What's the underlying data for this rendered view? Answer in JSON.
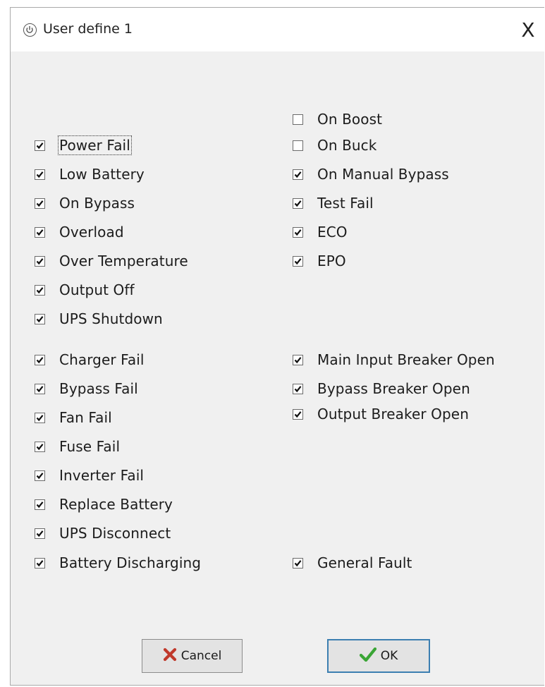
{
  "window": {
    "title": "User define 1",
    "close_label": "X"
  },
  "icons": {
    "app": "ups-power-icon",
    "close": "close-icon",
    "cancel": "red-x-icon",
    "ok": "green-check-icon"
  },
  "colors": {
    "dialog_bg": "#f0f0f0",
    "cancel_icon": "#c0392b",
    "ok_icon": "#3aa535",
    "ok_border": "#3c7fb1"
  },
  "options": {
    "on_boost": {
      "label": "On Boost",
      "checked": false
    },
    "on_buck": {
      "label": "On Buck",
      "checked": false
    },
    "power_fail": {
      "label": "Power Fail",
      "checked": true
    },
    "on_manual_bypass": {
      "label": "On Manual Bypass",
      "checked": true
    },
    "low_battery": {
      "label": "Low Battery",
      "checked": true
    },
    "test_fail": {
      "label": "Test Fail",
      "checked": true
    },
    "on_bypass": {
      "label": "On Bypass",
      "checked": true
    },
    "eco": {
      "label": "ECO",
      "checked": true
    },
    "overload": {
      "label": "Overload",
      "checked": true
    },
    "epo": {
      "label": "EPO",
      "checked": true
    },
    "over_temperature": {
      "label": "Over Temperature",
      "checked": true
    },
    "output_off": {
      "label": "Output Off",
      "checked": true
    },
    "ups_shutdown": {
      "label": "UPS Shutdown",
      "checked": true
    },
    "charger_fail": {
      "label": "Charger Fail",
      "checked": true
    },
    "main_input_breaker_open": {
      "label": "Main Input Breaker Open",
      "checked": true
    },
    "bypass_fail": {
      "label": "Bypass Fail",
      "checked": true
    },
    "bypass_breaker_open": {
      "label": "Bypass Breaker Open",
      "checked": true
    },
    "fan_fail": {
      "label": "Fan Fail",
      "checked": true
    },
    "output_breaker_open": {
      "label": "Output Breaker Open",
      "checked": true
    },
    "fuse_fail": {
      "label": "Fuse Fail",
      "checked": true
    },
    "inverter_fail": {
      "label": "Inverter Fail",
      "checked": true
    },
    "replace_battery": {
      "label": "Replace Battery",
      "checked": true
    },
    "ups_disconnect": {
      "label": "UPS Disconnect",
      "checked": true
    },
    "battery_discharging": {
      "label": "Battery Discharging",
      "checked": true
    },
    "general_fault": {
      "label": "General Fault",
      "checked": true
    }
  },
  "buttons": {
    "cancel": "Cancel",
    "ok": "OK"
  }
}
